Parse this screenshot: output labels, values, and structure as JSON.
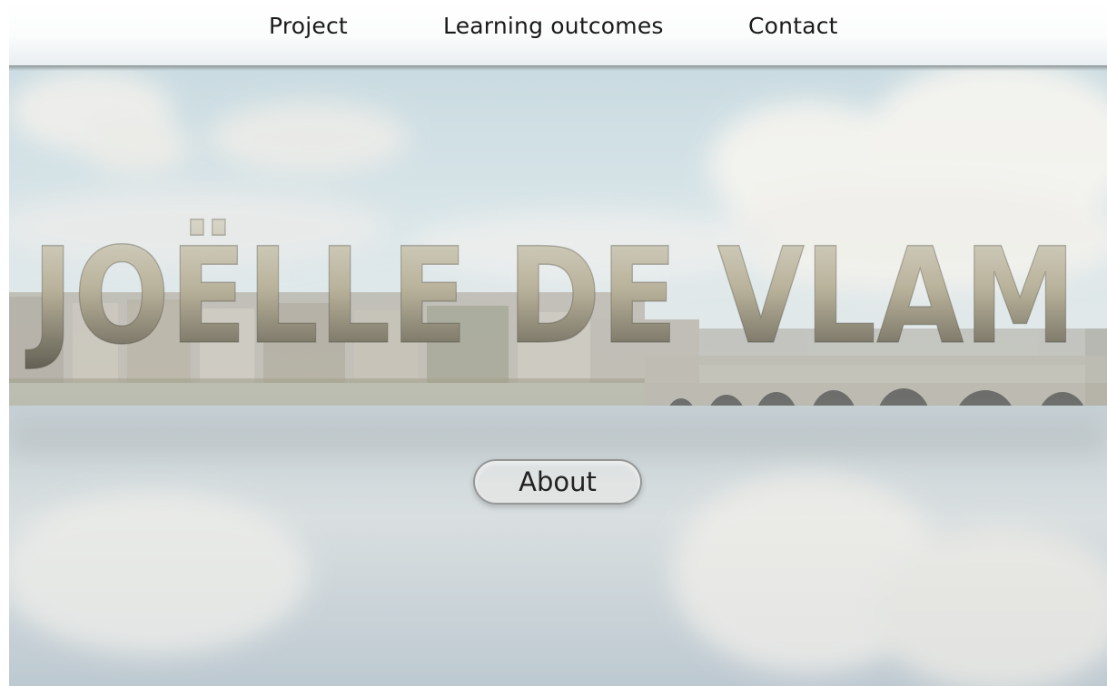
{
  "nav": {
    "items": [
      {
        "label": "Project"
      },
      {
        "label": "Learning outcomes"
      },
      {
        "label": "Contact"
      }
    ]
  },
  "hero": {
    "title": "JOËLLE DE VLAM",
    "about_label": "About"
  },
  "colors": {
    "sky": "#d3e2e7",
    "cloud": "#f4f2ee",
    "water": "#c2ced5",
    "title_fill": "#9a9582",
    "nav_text": "#1a1a1a"
  }
}
